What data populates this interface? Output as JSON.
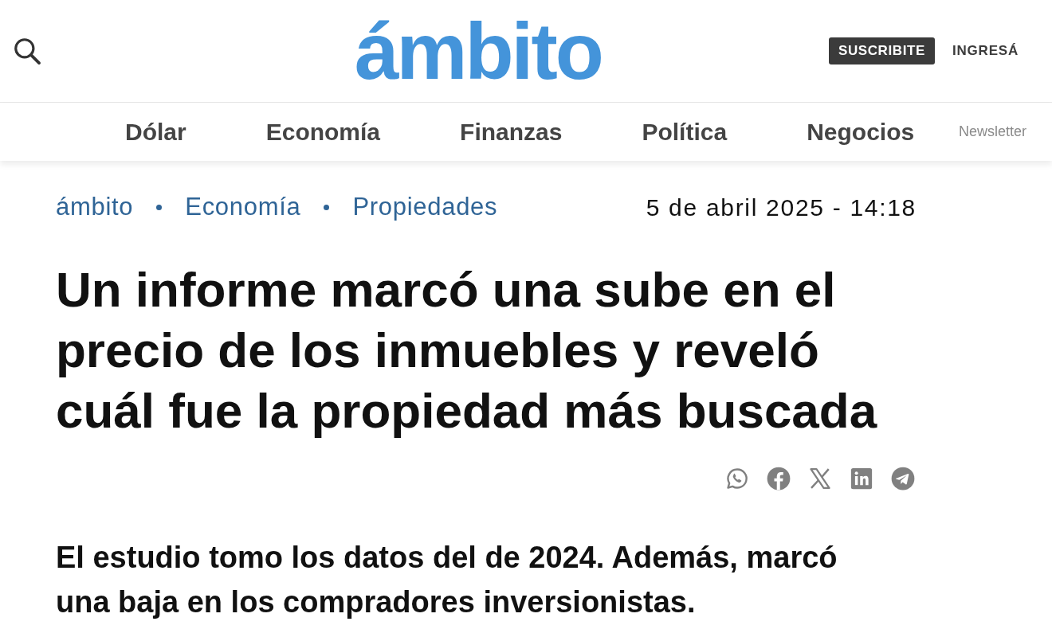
{
  "header": {
    "logo": "ámbito",
    "subscribe_button": "SUSCRIBITE",
    "login_link": "INGRESÁ"
  },
  "nav": {
    "items": [
      "Dólar",
      "Economía",
      "Finanzas",
      "Política",
      "Negocios"
    ],
    "newsletter_link": "Newsletter"
  },
  "article": {
    "breadcrumb": [
      "ámbito",
      "Economía",
      "Propiedades"
    ],
    "date": "5 de abril 2025 - 14:18",
    "headline": "Un informe marcó una sube en el precio de los inmuebles y reveló cuál fue la propiedad más buscada",
    "subtitle": "El estudio tomo los datos del de 2024. Además, marcó una baja en los compradores inversionistas."
  }
}
